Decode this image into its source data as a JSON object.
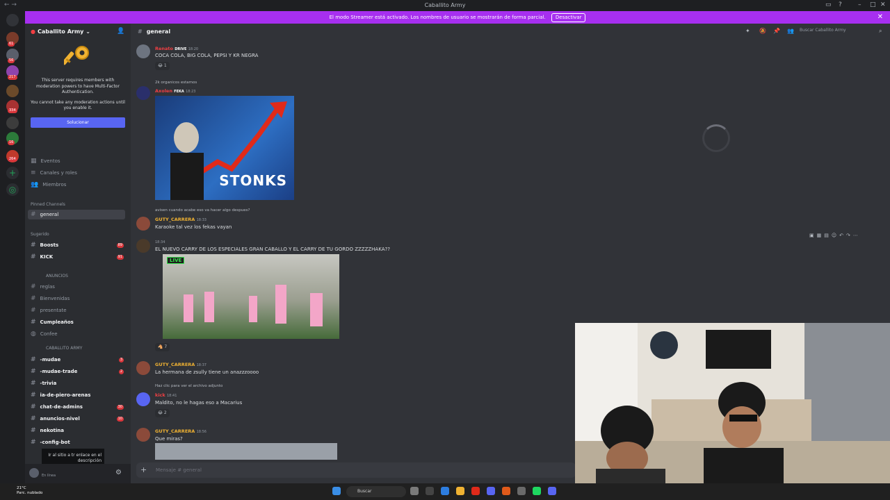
{
  "titlebar": {
    "title": "Caballito Army"
  },
  "banner": {
    "text": "El modo Streamer está activado. Los nombres de usuario se mostrarán de forma parcial.",
    "button": "Desactivar"
  },
  "rail": {
    "badges": [
      "61",
      "56",
      "217",
      "334",
      "16",
      "264"
    ]
  },
  "sidebar": {
    "guild_name": "Caballito Army",
    "mfa_text_1": "This server requires members with moderation powers to have Multi-Factor Authentication.",
    "mfa_text_2": "You cannot take any moderation actions until you enable it.",
    "mfa_button": "Solucionar",
    "nav": [
      "Eventos",
      "Canales y roles",
      "Miembros"
    ],
    "pinned_label": "Pinned Channels",
    "active_channel": "general",
    "suggested_label": "Sugerido",
    "suggested": [
      {
        "name": "Boosts",
        "badge": "89"
      },
      {
        "name": "KICK",
        "badge": "91"
      }
    ],
    "anuncios_cat": "ANUNCIOS",
    "anuncios": [
      "reglas",
      "Bienvenidas",
      "presentate",
      "Cumpleaños",
      "Confee"
    ],
    "army_cat": "CABALLITO ARMY",
    "army": [
      {
        "name": "-mudae",
        "badge": "3"
      },
      {
        "name": "-mudae-trade",
        "badge": "2"
      },
      {
        "name": "-trivia",
        "badge": ""
      },
      {
        "name": "ia-de-piero-arenas",
        "badge": ""
      },
      {
        "name": "chat-de-admins",
        "badge": "30"
      },
      {
        "name": "anuncios-nivel",
        "badge": "10"
      },
      {
        "name": "nekotina",
        "badge": ""
      },
      {
        "name": "-config-bot",
        "badge": ""
      }
    ],
    "overlay_text": "Ir al sitio a tr enlace en el descripción",
    "user_status": "En línea"
  },
  "chat": {
    "channel": "general",
    "search_placeholder": "Buscar Caballito Army",
    "messages": [
      {
        "author": "Renato",
        "tag": "DRIVE",
        "time": "18:20",
        "text": "COCA COLA, BIG COLA, PEPSI Y KR NEGRA",
        "reaction": "1"
      },
      {
        "reply": "2k organicos estamos",
        "author": "Axolen",
        "tag": "FEKA",
        "time": "18:23",
        "image_text": "STONKS"
      },
      {
        "reply": "avisen cuando acabe eso va hacer algo despues?",
        "author": "GUTY_CARRERA",
        "time": "18:33",
        "text": "Karaoke tal vez los fekas vayan"
      },
      {
        "time": "18:34",
        "text": "EL NUEVO CARRY DE LOS ESPECIALES GRAN CABALLO Y EL CARRY DE TU GORDO ZZZZZHAKA??",
        "live": "LIVE",
        "reaction": "7"
      },
      {
        "author": "GUTY_CARRERA",
        "time": "18:37",
        "text": "La hermana de zsully tiene un anazzzoooo"
      },
      {
        "reply": "Haz clic para ver el archivo adjunto",
        "author": "kick",
        "time": "18:41",
        "text": "Maldito, no le hagas eso a Macarius",
        "reaction": "2"
      },
      {
        "author": "GUTY_CARRERA",
        "time": "18:56",
        "text": "Que miras?"
      }
    ],
    "composer_placeholder": "Mensaje #",
    "composer_channel": "general"
  },
  "taskbar": {
    "temp": "21°C",
    "weather": "Parc. nublado",
    "search": "Buscar"
  }
}
